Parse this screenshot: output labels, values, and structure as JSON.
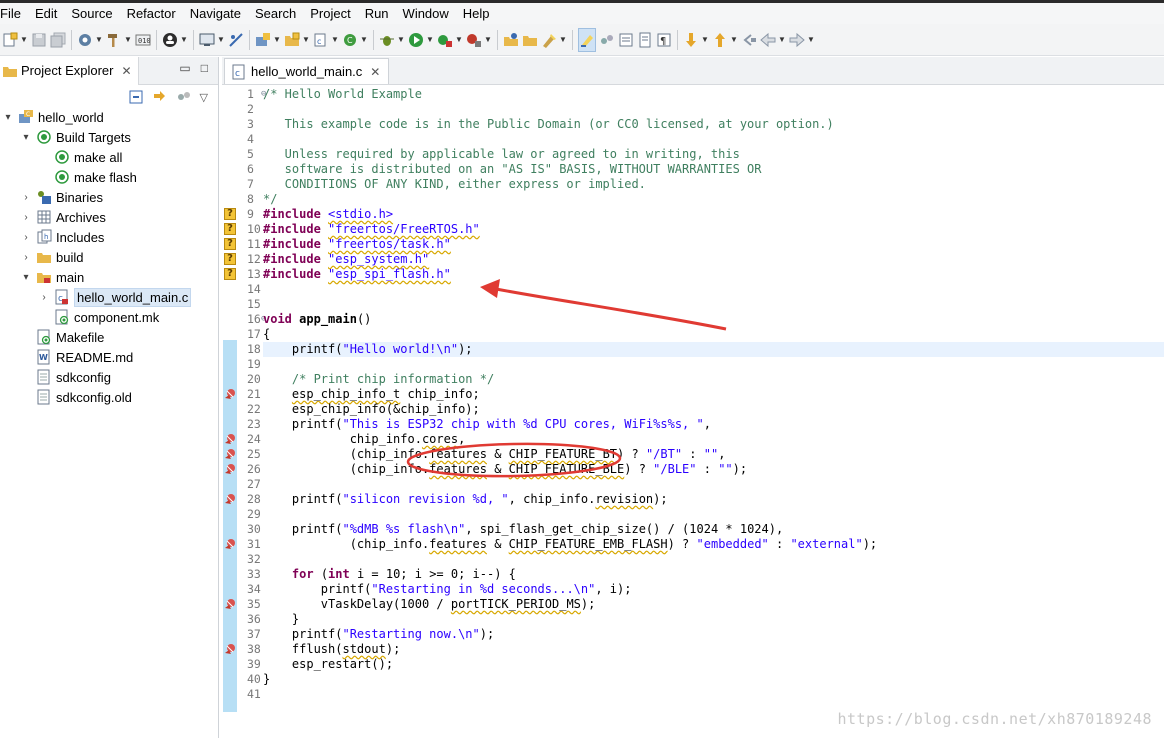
{
  "menu": [
    "File",
    "Edit",
    "Source",
    "Refactor",
    "Navigate",
    "Search",
    "Project",
    "Run",
    "Window",
    "Help"
  ],
  "explorer": {
    "title": "Project Explorer",
    "close_glyph": "✕",
    "minimize_glyph": "▭",
    "maximize_glyph": "□",
    "tree": [
      {
        "label": "hello_world",
        "depth": 0,
        "twisty": "▾",
        "icon": "project-icon"
      },
      {
        "label": "Build Targets",
        "depth": 1,
        "twisty": "▾",
        "icon": "target-icon"
      },
      {
        "label": "make all",
        "depth": 2,
        "twisty": "",
        "icon": "target-icon"
      },
      {
        "label": "make flash",
        "depth": 2,
        "twisty": "",
        "icon": "target-icon"
      },
      {
        "label": "Binaries",
        "depth": 1,
        "twisty": "›",
        "icon": "binaries-icon"
      },
      {
        "label": "Archives",
        "depth": 1,
        "twisty": "›",
        "icon": "archives-icon"
      },
      {
        "label": "Includes",
        "depth": 1,
        "twisty": "›",
        "icon": "includes-icon"
      },
      {
        "label": "build",
        "depth": 1,
        "twisty": "›",
        "icon": "folder-icon"
      },
      {
        "label": "main",
        "depth": 1,
        "twisty": "▾",
        "icon": "folder-open-icon"
      },
      {
        "label": "hello_world_main.c",
        "depth": 2,
        "twisty": "›",
        "icon": "c-file-icon",
        "selected": true
      },
      {
        "label": "component.mk",
        "depth": 2,
        "twisty": "",
        "icon": "make-file-icon"
      },
      {
        "label": "Makefile",
        "depth": 1,
        "twisty": "",
        "icon": "make-file-icon"
      },
      {
        "label": "README.md",
        "depth": 1,
        "twisty": "",
        "icon": "doc-icon"
      },
      {
        "label": "sdkconfig",
        "depth": 1,
        "twisty": "",
        "icon": "file-icon"
      },
      {
        "label": "sdkconfig.old",
        "depth": 1,
        "twisty": "",
        "icon": "file-icon"
      }
    ]
  },
  "editor": {
    "tab_label": "hello_world_main.c",
    "close_glyph": "✕",
    "fold_glyph": "⊖",
    "marker_glyph": "?",
    "lines": [
      {
        "n": "1",
        "fold": true,
        "html": "<span class=\"cmt\">/* Hello World Example</span>"
      },
      {
        "n": "2",
        "html": ""
      },
      {
        "n": "3",
        "html": "<span class=\"cmt\">   This example code is in the Public Domain (or CC0 licensed, at your option.)</span>"
      },
      {
        "n": "4",
        "html": ""
      },
      {
        "n": "5",
        "html": "<span class=\"cmt\">   Unless required by applicable law or agreed to in writing, this</span>"
      },
      {
        "n": "6",
        "html": "<span class=\"cmt\">   software is distributed on an \"AS IS\" BASIS, WITHOUT WARRANTIES OR</span>"
      },
      {
        "n": "7",
        "html": "<span class=\"cmt\">   CONDITIONS OF ANY KIND, either express or implied.</span>"
      },
      {
        "n": "8",
        "html": "<span class=\"cmt\">*/</span>"
      },
      {
        "n": "9",
        "marker": "q",
        "html": "<span class=\"pp\">#include</span> <span class=\"str sq\">&lt;stdio.h&gt;</span>"
      },
      {
        "n": "10",
        "marker": "q",
        "html": "<span class=\"pp\">#include</span> <span class=\"str sq\">\"freertos/FreeRTOS.h\"</span>"
      },
      {
        "n": "11",
        "marker": "q",
        "html": "<span class=\"pp\">#include</span> <span class=\"str sq\">\"freertos/task.h\"</span>"
      },
      {
        "n": "12",
        "marker": "q",
        "html": "<span class=\"pp\">#include</span> <span class=\"str sq\">\"esp_system.h\"</span>"
      },
      {
        "n": "13",
        "marker": "q",
        "html": "<span class=\"pp\">#include</span> <span class=\"str sq\">\"esp_spi_flash.h\"</span>"
      },
      {
        "n": "14",
        "html": ""
      },
      {
        "n": "15",
        "html": ""
      },
      {
        "n": "16",
        "fold": true,
        "html": "<span class=\"kw\">void</span> <span class=\"fn\">app_main</span>()"
      },
      {
        "n": "17",
        "html": "{"
      },
      {
        "n": "18",
        "hl": true,
        "html": "    printf(<span class=\"str\">\"Hello world!\\n\"</span>);"
      },
      {
        "n": "19",
        "html": ""
      },
      {
        "n": "20",
        "html": "    <span class=\"cmt\">/* Print chip information */</span>"
      },
      {
        "n": "21",
        "marker": "b",
        "html": "    <span class=\"sq\">esp_chip_info_t</span> chip_info;"
      },
      {
        "n": "22",
        "html": "    esp_chip_info(&amp;chip_info);"
      },
      {
        "n": "23",
        "html": "    printf(<span class=\"str\">\"This is ESP32 chip with %d CPU cores, WiFi%s%s, \"</span>,"
      },
      {
        "n": "24",
        "marker": "b",
        "html": "            chip_info.<span class=\"sq\">cores</span>,"
      },
      {
        "n": "25",
        "marker": "b",
        "html": "            (chip_info.<span class=\"sq\">features</span> &amp; <span class=\"sq\">CHIP_FEATURE_BT</span>) ? <span class=\"str\">\"/BT\"</span> : <span class=\"str\">\"\"</span>,"
      },
      {
        "n": "26",
        "marker": "b",
        "html": "            (chip_info.<span class=\"sq\">features</span> &amp; <span class=\"sq\">CHIP_FEATURE_BLE</span>) ? <span class=\"str\">\"/BLE\"</span> : <span class=\"str\">\"\"</span>);"
      },
      {
        "n": "27",
        "html": ""
      },
      {
        "n": "28",
        "marker": "b",
        "html": "    printf(<span class=\"str\">\"silicon revision %d, \"</span>, chip_info.<span class=\"sq\">revision</span>);"
      },
      {
        "n": "29",
        "html": ""
      },
      {
        "n": "30",
        "html": "    printf(<span class=\"str\">\"%dMB %s flash\\n\"</span>, spi_flash_get_chip_size() / (1024 * 1024),"
      },
      {
        "n": "31",
        "marker": "b",
        "html": "            (chip_info.<span class=\"sq\">features</span> &amp; <span class=\"sq\">CHIP_FEATURE_EMB_FLASH</span>) ? <span class=\"str\">\"embedded\"</span> : <span class=\"str\">\"external\"</span>);"
      },
      {
        "n": "32",
        "html": ""
      },
      {
        "n": "33",
        "html": "    <span class=\"kw\">for</span> (<span class=\"kw\">int</span> i = 10; i &gt;= 0; i--) {"
      },
      {
        "n": "34",
        "html": "        printf(<span class=\"str\">\"Restarting in %d seconds...\\n\"</span>, i);"
      },
      {
        "n": "35",
        "marker": "b",
        "html": "        vTaskDelay(1000 / <span class=\"sq\">portTICK_PERIOD_MS</span>);"
      },
      {
        "n": "36",
        "html": "    }"
      },
      {
        "n": "37",
        "html": "    printf(<span class=\"str\">\"Restarting now.\\n\"</span>);"
      },
      {
        "n": "38",
        "marker": "b",
        "html": "    fflush(<span class=\"sq\">stdout</span>);"
      },
      {
        "n": "39",
        "html": "    esp_restart();"
      },
      {
        "n": "40",
        "html": "}"
      },
      {
        "n": "41",
        "html": ""
      }
    ]
  },
  "watermark": "https://blog.csdn.net/xh870189248",
  "colors": {
    "annotation_red": "#e03a33",
    "selection_blue": "#dbe8f6",
    "current_line": "#e8f2fe"
  }
}
